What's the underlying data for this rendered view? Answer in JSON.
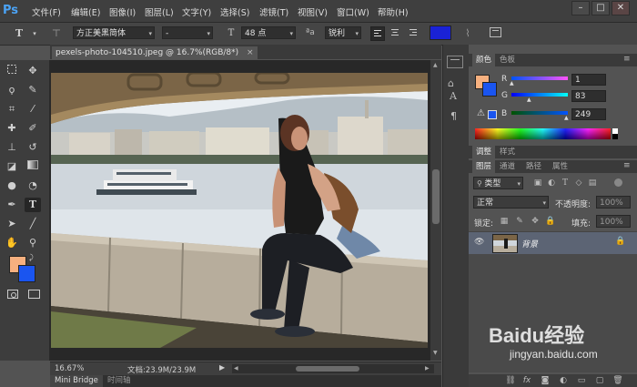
{
  "app": {
    "logo": "Ps"
  },
  "menu": [
    "文件(F)",
    "编辑(E)",
    "图像(I)",
    "图层(L)",
    "文字(Y)",
    "选择(S)",
    "滤镜(T)",
    "视图(V)",
    "窗口(W)",
    "帮助(H)"
  ],
  "window_controls": {
    "minimize": "–",
    "restore": "□",
    "close": "✕"
  },
  "options_bar": {
    "font_family": "方正美黑简体",
    "font_style": "-",
    "font_size": "48 点",
    "aa_label": "ªa",
    "antialias": "锐利",
    "text_color": "#1a22d6"
  },
  "document": {
    "tab_title": "pexels-photo-104510.jpeg @ 16.7%(RGB/8*)",
    "tab_close": "×"
  },
  "status": {
    "zoom": "16.67%",
    "doc_info": "文档:23.9M/23.9M"
  },
  "bottom_tabs": [
    "Mini Bridge",
    "时间轴"
  ],
  "color_panel": {
    "tabs": [
      "颜色",
      "色板"
    ],
    "channels": [
      {
        "label": "R",
        "value": "1"
      },
      {
        "label": "G",
        "value": "83"
      },
      {
        "label": "B",
        "value": "249"
      }
    ],
    "foreground": "#f6b07f",
    "background": "#1a55f0"
  },
  "adjust_tabs": [
    "调整",
    "样式"
  ],
  "layers_panel": {
    "tabs": [
      "图层",
      "通道",
      "路径",
      "属性"
    ],
    "filter": "类型",
    "blend_mode": "正常",
    "opacity_label": "不透明度:",
    "opacity_value": "100%",
    "lock_label": "锁定:",
    "fill_label": "填充:",
    "fill_value": "100%",
    "layers": [
      {
        "name": "背景"
      }
    ]
  },
  "watermark": {
    "brand": "Baidu经验",
    "url": "jingyan.baidu.com"
  }
}
